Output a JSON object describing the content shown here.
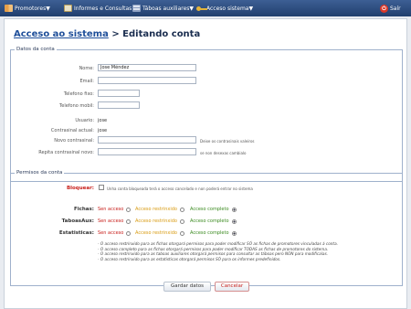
{
  "topbar": {
    "menu": [
      {
        "label": "Promotores▼",
        "icon": "people-icon"
      },
      {
        "label": "Informes e Consultas",
        "icon": "book-icon"
      },
      {
        "label": "Táboas auxiliares▼",
        "icon": "table-icon"
      },
      {
        "label": "Acceso sistema▼",
        "icon": "key-icon"
      }
    ],
    "exit_label": "Saír"
  },
  "title": {
    "link": "Acceso ao sistema",
    "rest": " > Editando conta"
  },
  "account": {
    "legend": "Datos da conta",
    "fields": [
      {
        "label": "Nome:",
        "value": "Jose Méndez"
      },
      {
        "label": "Email:",
        "value": ""
      },
      {
        "label": "Telefono fixo:",
        "value": ""
      },
      {
        "label": "Telefono mobil:",
        "value": ""
      }
    ],
    "user_label": "Usuario:",
    "user_value": "jose",
    "current_pw_label": "Contrasinal actual:",
    "current_pw_value": "jose",
    "new_pw_label": "Novo contrasinal:",
    "new_pw_hint": "Deixe os contrasinais valeiros",
    "repeat_pw_label": "Repita contrasinal novo:",
    "repeat_pw_hint": "se non desexas cambialo"
  },
  "permissions": {
    "legend": "Permisos da conta",
    "block_label": "Bloquear:",
    "block_text": "Unha conta bloqueada terá o acceso cancelado e non poderá entrar no sistema",
    "options": {
      "none": "Sen acceso",
      "restricted": "Acceso restrinxido",
      "full": "Acceso completo"
    },
    "rows": [
      {
        "label": "Fichas:",
        "selected": "full"
      },
      {
        "label": "TaboasAux:",
        "selected": "full"
      },
      {
        "label": "Estatisticas:",
        "selected": "full"
      }
    ],
    "notes": [
      "- O acceso restrinxido para as fichas otorgará permisos para poder modificar SÓ as fichas de promotores vinculadas á conta.",
      "- O acceso completo para as fichas otorgará permisos para poder modificar TODAS as fichas de promotores do sistema.",
      "- O acceso restrinxido para as taboas auxiliares otorgará permisos para consultar as táboas pero NON para modificalas.",
      "- O acceso restrinxido para as estatisticas otorgará permisos SÓ para os informes predefinidos."
    ]
  },
  "buttons": {
    "save": "Gardar datos",
    "cancel": "Cancelar"
  }
}
